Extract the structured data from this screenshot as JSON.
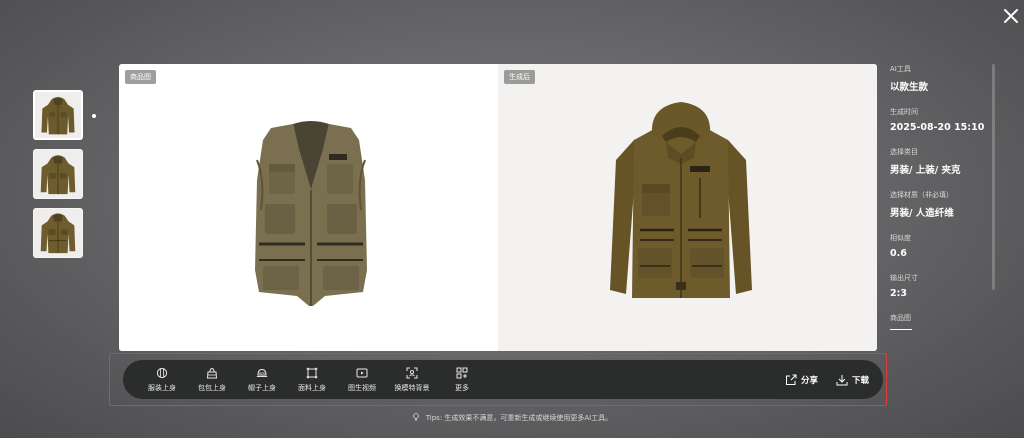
{
  "thumbnails": [
    {
      "label": "jacket-thumbnail-1"
    },
    {
      "label": "jacket-thumbnail-2"
    },
    {
      "label": "jacket-thumbnail-3"
    }
  ],
  "viewer": {
    "left_tag": "商品图",
    "right_tag": "生成后"
  },
  "info": {
    "tool_label": "AI工具",
    "tool_value": "以款生款",
    "time_label": "生成时间",
    "time_value": "2025-08-20 15:10",
    "category_label": "选择类目",
    "category_value": "男装/ 上装/ 夹克",
    "material_label": "选择材质（非必填）",
    "material_value": "男装/ 人造纤维",
    "similarity_label": "相似度",
    "similarity_value": "0.6",
    "size_label": "输出尺寸",
    "size_value": "2:3",
    "product_label": "商品图"
  },
  "toolbar": {
    "tools": [
      {
        "label": "服装上身",
        "icon": "shirt-icon"
      },
      {
        "label": "包包上身",
        "icon": "bag-icon"
      },
      {
        "label": "帽子上身",
        "icon": "hat-icon"
      },
      {
        "label": "面料上身",
        "icon": "fabric-icon"
      },
      {
        "label": "图生视频",
        "icon": "video-icon"
      },
      {
        "label": "换模特背景",
        "icon": "scan-icon"
      },
      {
        "label": "更多",
        "icon": "grid-icon"
      }
    ],
    "share_label": "分享",
    "download_label": "下载"
  },
  "tips": "Tips: 生成效果不满意，可重新生成或继续使用更多AI工具。",
  "colors": {
    "toolbar_bg": "#2b2c2c",
    "highlight": "#e23b3b",
    "jacket": "#6b5a2c",
    "vest": "#766b4c"
  }
}
